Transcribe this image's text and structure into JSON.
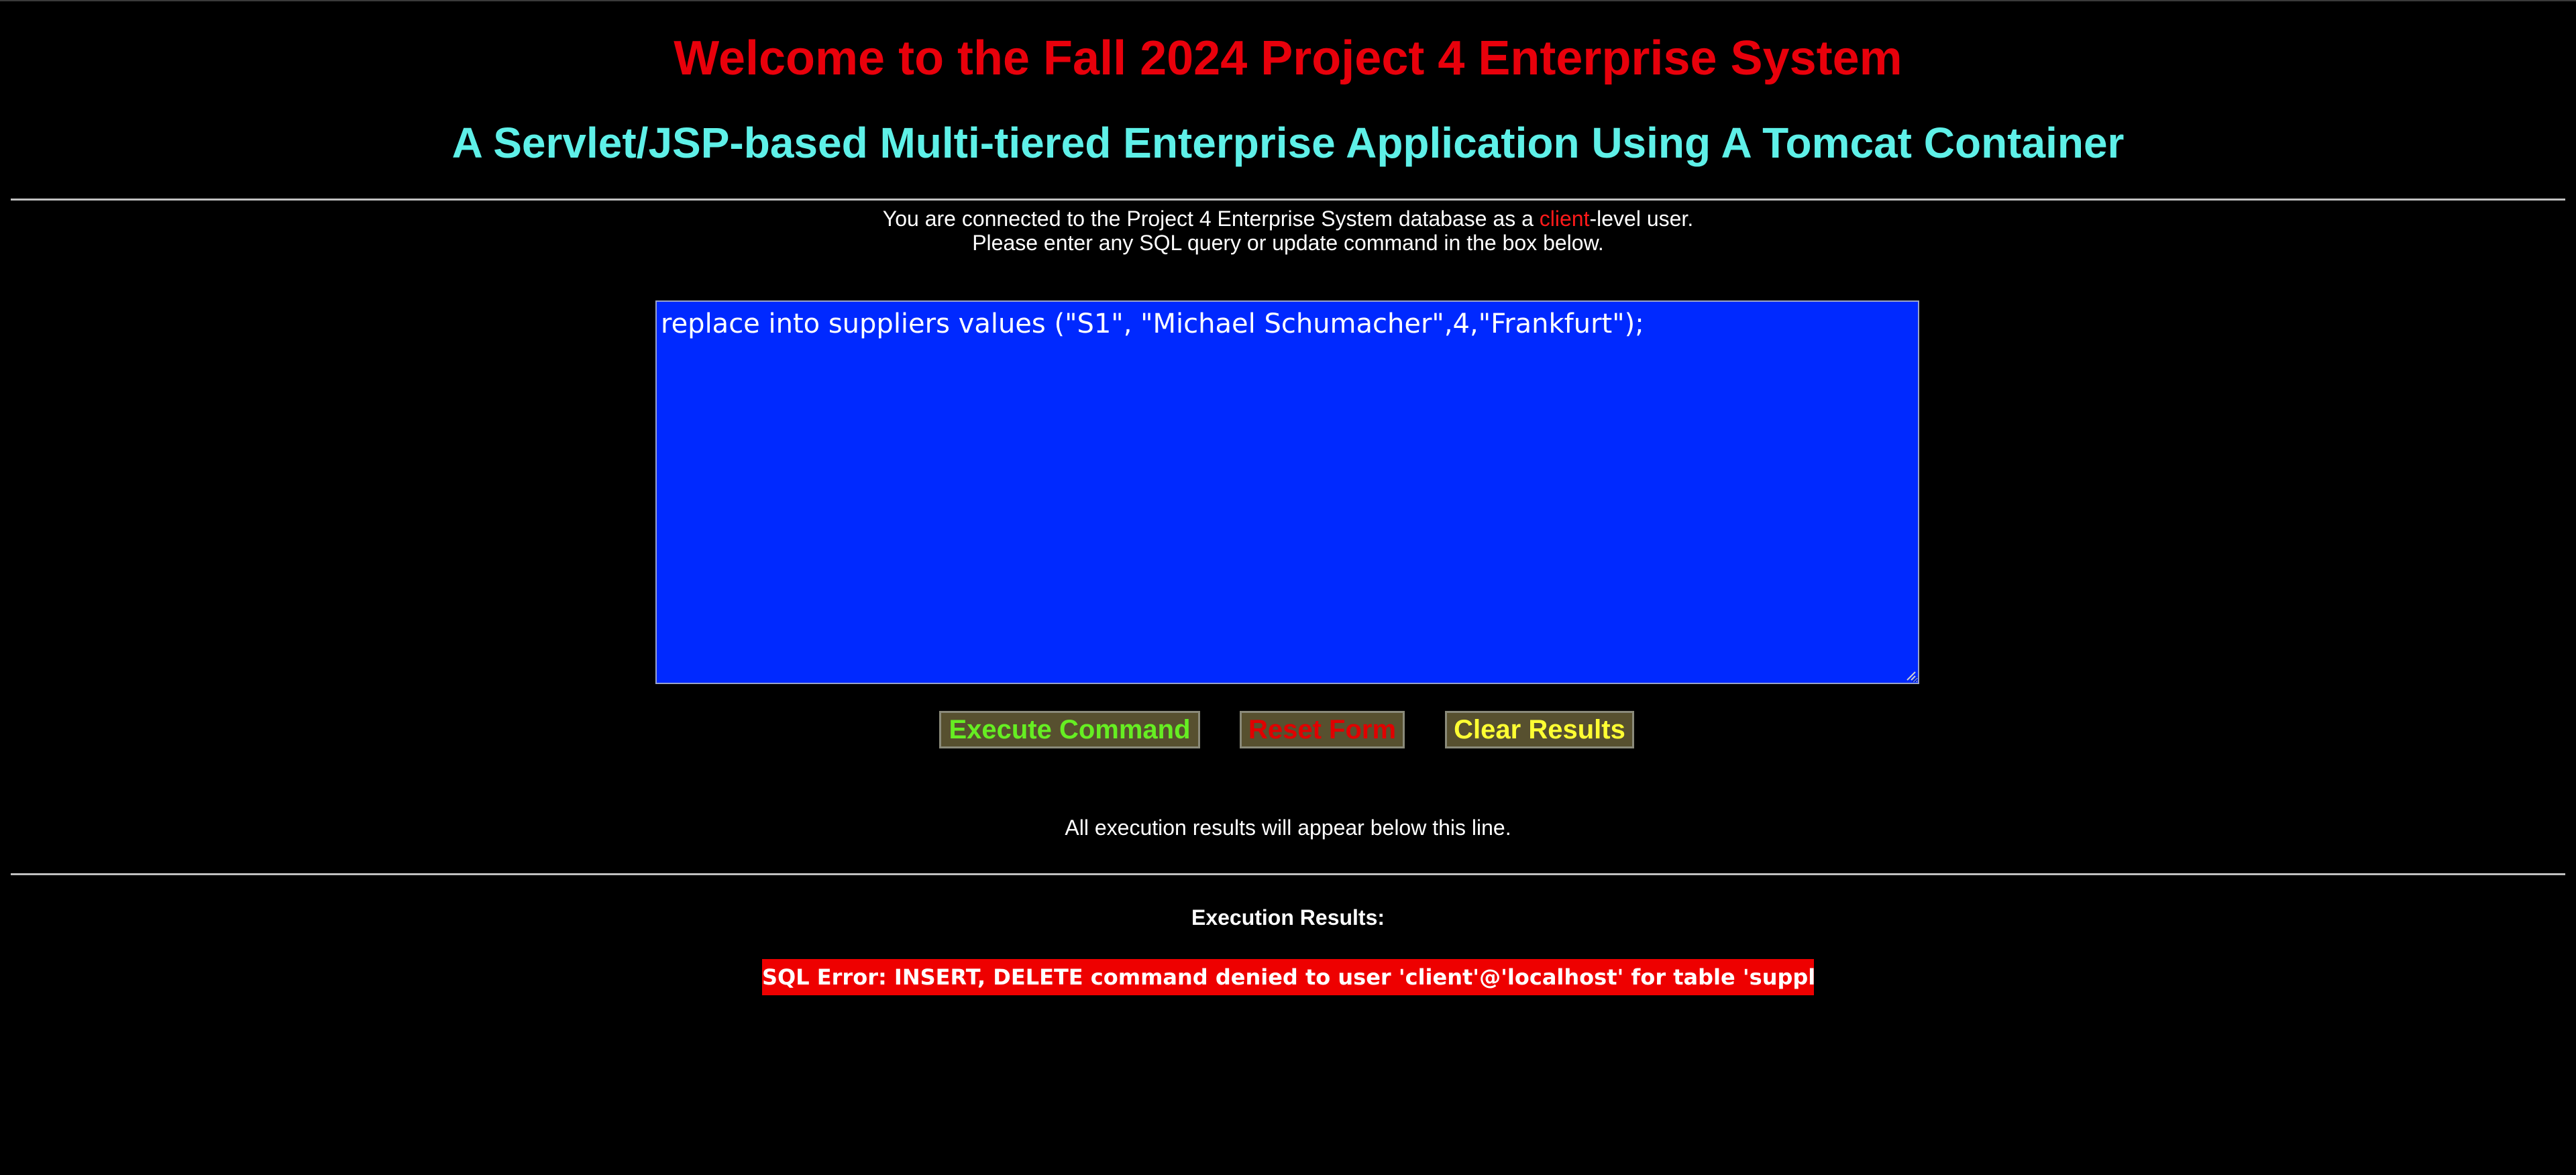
{
  "header": {
    "title": "Welcome to the Fall 2024 Project 4 Enterprise System",
    "subtitle": "A Servlet/JSP-based Multi-tiered Enterprise Application Using A Tomcat Container"
  },
  "intro": {
    "line1_before": "You are connected to the Project 4 Enterprise System database as a ",
    "user_level": "client",
    "line1_after": "-level user.",
    "line2": "Please enter any SQL query or update command in the box below."
  },
  "query": {
    "value": "replace into suppliers values (\"S1\", \"Michael Schumacher\",4,\"Frankfurt\");"
  },
  "buttons": {
    "execute_label": "Execute Command",
    "reset_label": "Reset Form",
    "clear_label": "Clear Results"
  },
  "results": {
    "below_note": "All execution results will appear below this line.",
    "heading": "Execution Results:",
    "error_message": "SQL Error: INSERT, DELETE command denied to user 'client'@'localhost' for table 'suppliers'"
  },
  "colors": {
    "background": "#000000",
    "title": "#e8000b",
    "subtitle": "#5ef0e8",
    "user_level": "#ff1a1a",
    "query_background": "#0029ff",
    "button_background": "#57502f",
    "execute_text": "#66ee22",
    "reset_text": "#e00000",
    "clear_text": "#ffff33",
    "error_background": "#ee0000",
    "error_text": "#ffffff"
  },
  "icons": {
    "resize_grip": "resize-grip-icon"
  }
}
